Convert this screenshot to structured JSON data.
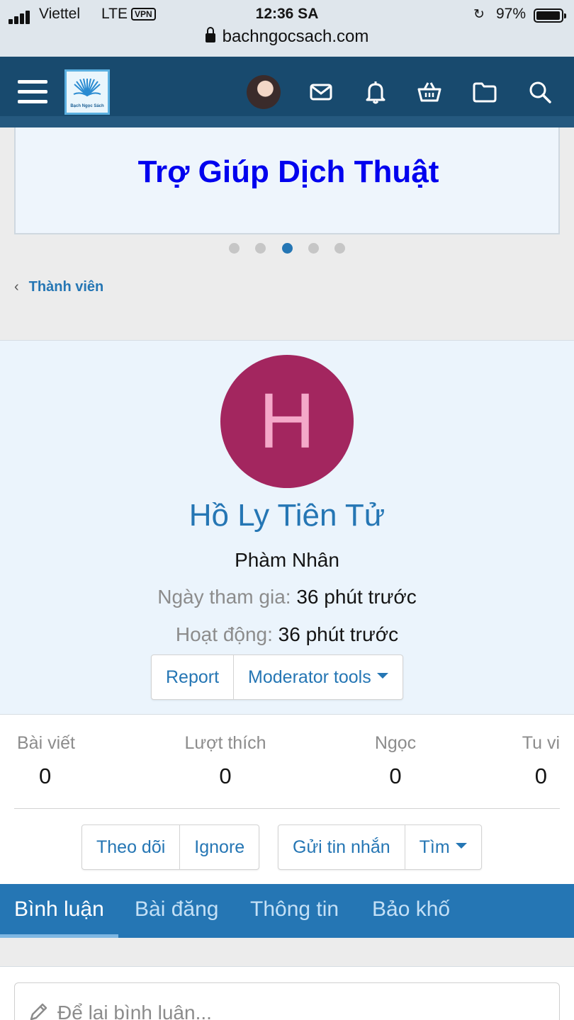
{
  "status_bar": {
    "carrier": "Viettel",
    "network": "LTE",
    "vpn": "VPN",
    "time": "12:36 SA",
    "battery": "97%"
  },
  "browser": {
    "url": "bachngocsach.com"
  },
  "navbar": {
    "logo_text": "Bạch Ngọc Sách",
    "icons": [
      "menu-icon",
      "avatar",
      "mail-icon",
      "bell-icon",
      "basket-icon",
      "folder-icon",
      "search-icon"
    ]
  },
  "banner": {
    "text": "Trợ Giúp Dịch Thuật",
    "slides": 5,
    "active_slide": 3
  },
  "breadcrumb": {
    "label": "Thành viên"
  },
  "profile": {
    "avatar_letter": "H",
    "username": "Hồ Ly Tiên Tử",
    "rank": "Phàm Nhân",
    "joined_label": "Ngày tham gia:",
    "joined_value": "36 phút trước",
    "active_label": "Hoạt động:",
    "active_value": "36 phút trước",
    "report_label": "Report",
    "moderator_label": "Moderator tools"
  },
  "stats": [
    {
      "label": "Bài viết",
      "value": "0"
    },
    {
      "label": "Lượt thích",
      "value": "0"
    },
    {
      "label": "Ngọc",
      "value": "0"
    },
    {
      "label": "Tu vi",
      "value": "0"
    }
  ],
  "actions": {
    "follow": "Theo dõi",
    "ignore": "Ignore",
    "message": "Gửi tin nhắn",
    "find": "Tìm"
  },
  "tabs": [
    {
      "label": "Bình luận",
      "active": true
    },
    {
      "label": "Bài đăng",
      "active": false
    },
    {
      "label": "Thông tin",
      "active": false
    },
    {
      "label": "Bảo khố",
      "active": false
    }
  ],
  "comment": {
    "placeholder": "Để lại bình luận..."
  },
  "colors": {
    "navbar": "#184a6e",
    "accent": "#2576b4",
    "avatar_bg": "#a3265f",
    "avatar_letter": "#f4a9c9",
    "banner_text": "#0000ee"
  }
}
